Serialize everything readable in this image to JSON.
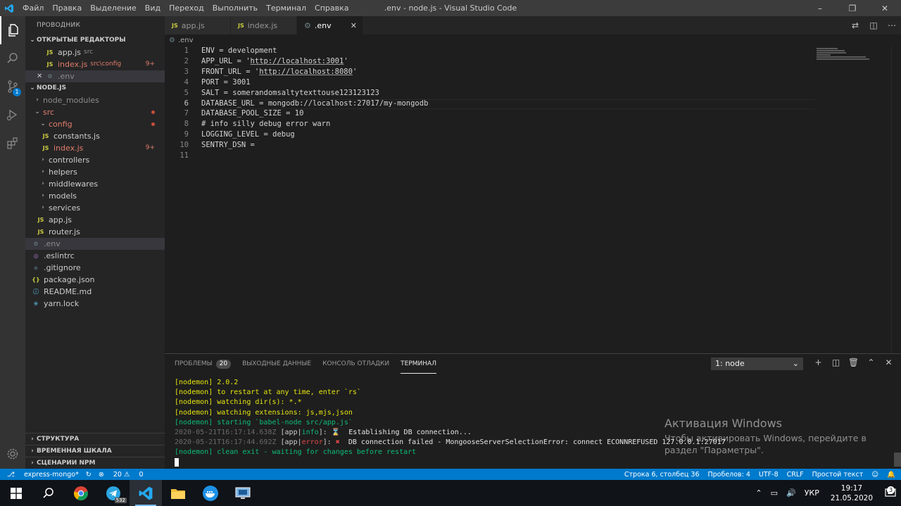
{
  "window": {
    "title": ".env - node.js - Visual Studio Code",
    "menu": [
      "Файл",
      "Правка",
      "Выделение",
      "Вид",
      "Переход",
      "Выполнить",
      "Терминал",
      "Справка"
    ]
  },
  "sidebar": {
    "title": "ПРОВОДНИК",
    "open_editors_title": "ОТКРЫТЫЕ РЕДАКТОРЫ",
    "open_editors": [
      {
        "name": "app.js",
        "path": "src",
        "icon": "JS"
      },
      {
        "name": "index.js",
        "path": "src\\config",
        "count": "9+",
        "icon": "JS"
      },
      {
        "name": ".env",
        "icon": "gear"
      }
    ],
    "project_title": "NODE.JS",
    "tree": [
      {
        "name": "node_modules"
      },
      {
        "name": "src"
      },
      {
        "name": "config"
      },
      {
        "name": "constants.js",
        "icon": "JS"
      },
      {
        "name": "index.js",
        "icon": "JS",
        "count": "9+"
      },
      {
        "name": "controllers"
      },
      {
        "name": "helpers"
      },
      {
        "name": "middlewares"
      },
      {
        "name": "models"
      },
      {
        "name": "services"
      },
      {
        "name": "app.js",
        "icon": "JS"
      },
      {
        "name": "router.js",
        "icon": "JS"
      },
      {
        "name": ".env",
        "icon": "gear"
      },
      {
        "name": ".eslintrc",
        "icon": "eslint"
      },
      {
        "name": ".gitignore",
        "icon": "git"
      },
      {
        "name": "package.json",
        "icon": "{}"
      },
      {
        "name": "README.md",
        "icon": "info"
      },
      {
        "name": "yarn.lock",
        "icon": "yarn"
      }
    ],
    "bottom_sections": [
      "СТРУКТУРА",
      "ВРЕМЕННАЯ ШКАЛА",
      "СЦЕНАРИИ NPM"
    ]
  },
  "tabs": [
    {
      "label": "app.js",
      "icon": "JS"
    },
    {
      "label": "index.js",
      "icon": "JS"
    },
    {
      "label": ".env",
      "icon": "gear",
      "active": true
    }
  ],
  "breadcrumb": ".env",
  "editor": {
    "lines": [
      {
        "n": "1",
        "text": "ENV = development"
      },
      {
        "n": "2",
        "pre": "APP_URL = '",
        "link": "http://localhost:3001",
        "post": "'"
      },
      {
        "n": "3",
        "pre": "FRONT_URL = '",
        "link": "http://localhost:8080",
        "post": "'"
      },
      {
        "n": "4",
        "text": "PORT = 3001"
      },
      {
        "n": "5",
        "text": "SALT = somerandomsaltytexttouse123123123"
      },
      {
        "n": "6",
        "text": "DATABASE_URL = mongodb://localhost:27017/my-mongodb"
      },
      {
        "n": "7",
        "text": "DATABASE_POOL_SIZE = 10"
      },
      {
        "n": "8",
        "text": "# info silly debug error warn"
      },
      {
        "n": "9",
        "text": "LOGGING_LEVEL = debug"
      },
      {
        "n": "10",
        "text": "SENTRY_DSN ="
      },
      {
        "n": "11",
        "text": ""
      }
    ]
  },
  "panel": {
    "tabs": [
      {
        "label": "ПРОБЛЕМЫ",
        "badge": "20"
      },
      {
        "label": "ВЫХОДНЫЕ ДАННЫЕ"
      },
      {
        "label": "КОНСОЛЬ ОТЛАДКИ"
      },
      {
        "label": "ТЕРМИНАЛ",
        "active": true
      }
    ],
    "terminal_select": "1: node",
    "terminal": [
      {
        "cls": "yl",
        "text": "[nodemon] 2.0.2"
      },
      {
        "cls": "yl",
        "text": "[nodemon] to restart at any time, enter `rs`"
      },
      {
        "cls": "yl",
        "text": "[nodemon] watching dir(s): *.*"
      },
      {
        "cls": "yl",
        "text": "[nodemon] watching extensions: js,mjs,json"
      },
      {
        "cls": "gr",
        "text": "[nodemon] starting `babel-node src/app.js`"
      },
      {
        "ts": "2020-05-21T16:17:14.638Z",
        "tag1": " [app|",
        "level": "info",
        "tag2": "]: ",
        "icon": "⌛",
        "msg": "  Establishing DB connection..."
      },
      {
        "ts": "2020-05-21T16:17:44.692Z",
        "tag1": " [app|",
        "level": "error",
        "tag2": "]: ",
        "icon": "✖",
        "msg": "  DB connection failed - MongooseServerSelectionError: connect ECONNREFUSED 127.0.0.1:27017"
      },
      {
        "cls": "gr",
        "text": "[nodemon] clean exit - waiting for changes before restart"
      }
    ]
  },
  "watermark": {
    "title": "Активация Windows",
    "line1": "Чтобы активировать Windows, перейдите в",
    "line2": "раздел \"Параметры\"."
  },
  "statusbar": {
    "branch": "express-mongo*",
    "errors": "20",
    "warnings": "0",
    "position": "Строка 6, столбец 36",
    "spaces": "Пробелов: 4",
    "encoding": "UTF-8",
    "eol": "CRLF",
    "language": "Простой текст"
  },
  "taskbar": {
    "telegram_badge": "532",
    "lang": "УКР",
    "time": "19:17",
    "date": "21.05.2020",
    "notifications": "3"
  },
  "colors": {
    "statusbar": "#007acc",
    "activitybar": "#333333",
    "sidebar": "#252526",
    "editor": "#1e1e1e"
  }
}
